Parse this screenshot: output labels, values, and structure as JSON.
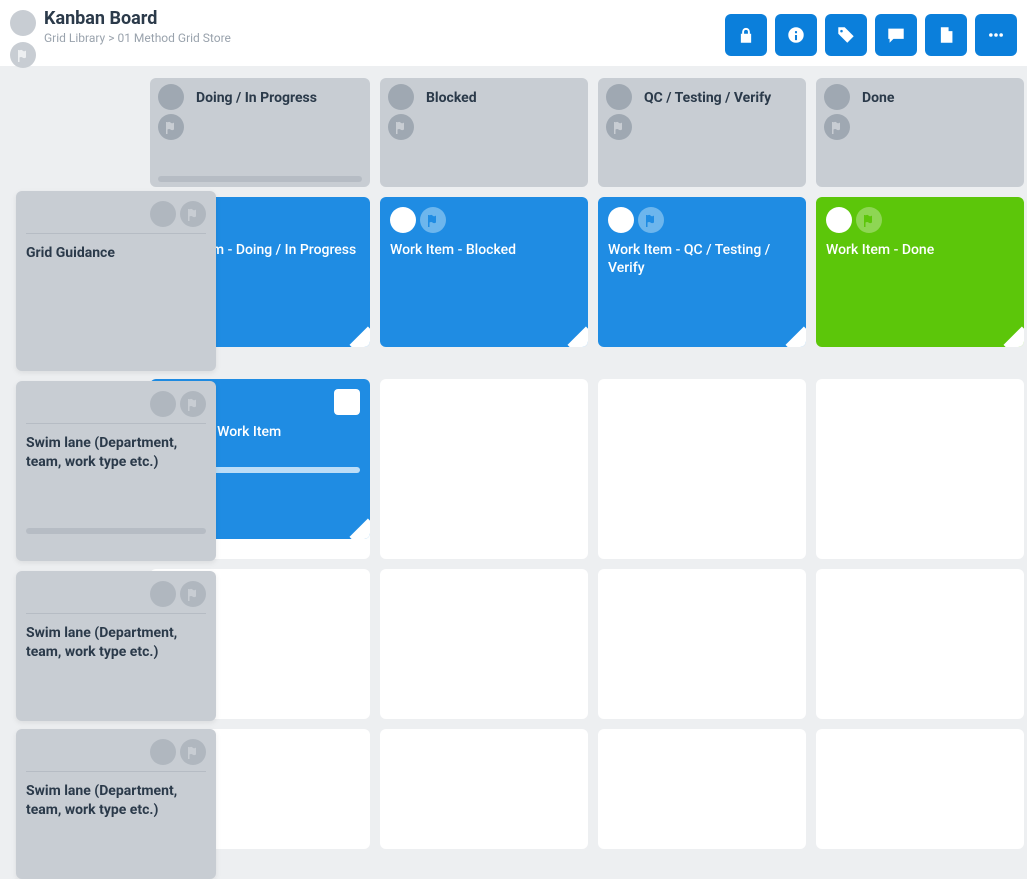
{
  "header": {
    "title": "Kanban Board",
    "breadcrumb_prefix": "Grid Library",
    "breadcrumb_sep": " > ",
    "breadcrumb_current": "01 Method Grid Store"
  },
  "columns": [
    {
      "label": "Doing / In Progress"
    },
    {
      "label": "Blocked"
    },
    {
      "label": "QC / Testing / Verify"
    },
    {
      "label": "Done"
    }
  ],
  "side": [
    {
      "label": "Grid Guidance"
    },
    {
      "label": "Swim lane (Department, team, work type etc.)"
    },
    {
      "label": "Swim lane (Department, team, work type etc.)"
    },
    {
      "label": "Swim lane (Department, team, work type etc.)"
    }
  ],
  "cards": {
    "doing": "Work Item - Doing / In Progress",
    "blocked": "Work Item - Blocked",
    "qc": "Work Item - QC / Testing / Verify",
    "done": "Work Item - Done",
    "example": "Example Work Item"
  }
}
